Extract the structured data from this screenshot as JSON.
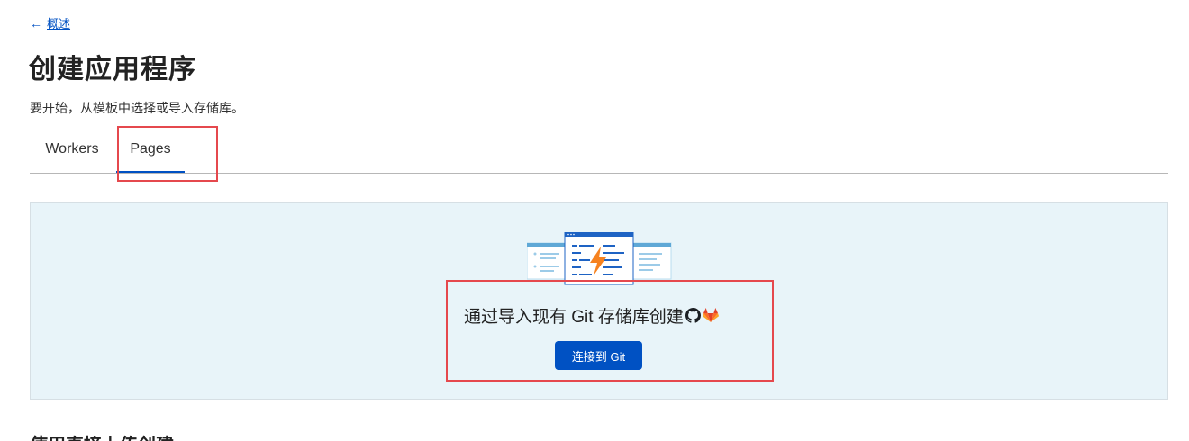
{
  "nav": {
    "back_arrow": "←",
    "back_label": "概述"
  },
  "header": {
    "title": "创建应用程序",
    "subtitle": "要开始，从模板中选择或导入存储库。"
  },
  "tabs": [
    {
      "label": "Workers",
      "active": false
    },
    {
      "label": "Pages",
      "active": true
    }
  ],
  "git_card": {
    "heading": "通过导入现有 Git 存储库创建",
    "icons": [
      "github-icon",
      "gitlab-icon"
    ],
    "button_label": "连接到 Git"
  },
  "direct_upload": {
    "heading": "使用直接上传创建"
  },
  "colors": {
    "accent": "#0051c3",
    "highlight": "#e5484d",
    "card_background": "#e8f4f9",
    "bolt": "#f6821f"
  }
}
